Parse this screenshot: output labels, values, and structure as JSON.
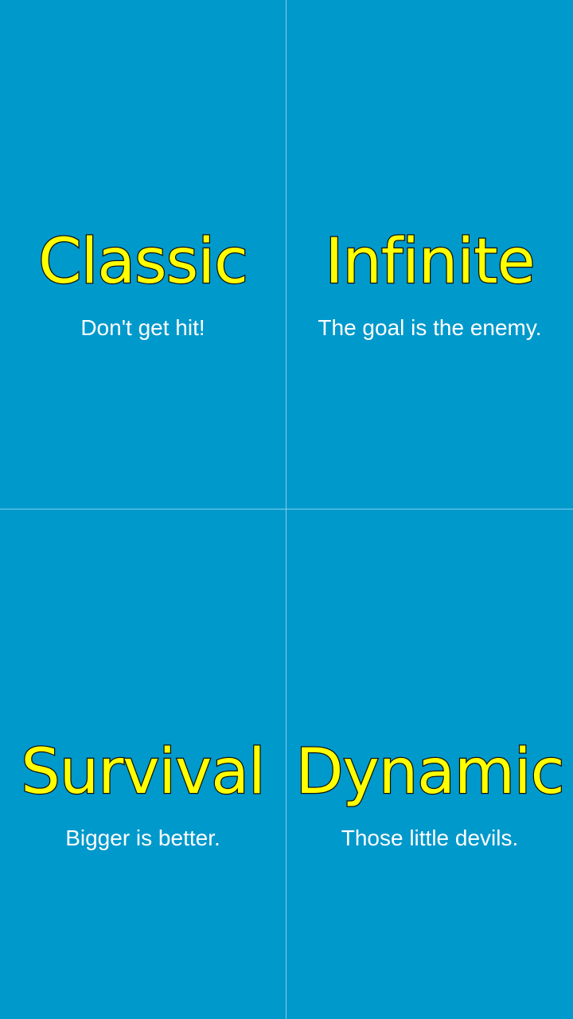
{
  "modes": [
    {
      "title": "Classic",
      "subtitle": "Don't get hit!"
    },
    {
      "title": "Infinite",
      "subtitle": "The goal is the enemy."
    },
    {
      "title": "Survival",
      "subtitle": "Bigger is better."
    },
    {
      "title": "Dynamic",
      "subtitle": "Those little devils."
    }
  ],
  "colors": {
    "background": "#0099cc",
    "title_fill": "#ffff00",
    "title_outline": "#111111",
    "subtitle": "#ffffff",
    "divider": "#7fd0ec"
  }
}
